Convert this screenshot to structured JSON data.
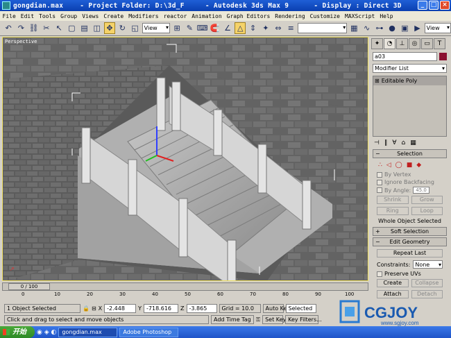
{
  "window": {
    "title": "gongdian.max    - Project Folder: D:\\3d_F     - Autodesk 3ds Max 9      - Display : Direct 3D"
  },
  "menu": [
    "File",
    "Edit",
    "Tools",
    "Group",
    "Views",
    "Create",
    "Modifiers",
    "reactor",
    "Animation",
    "Graph Editors",
    "Rendering",
    "Customize",
    "MAXScript",
    "Help"
  ],
  "toolbar": {
    "refcoord_label": "View",
    "named_sel_label": "View"
  },
  "viewport": {
    "label": "Perspective"
  },
  "command_panel": {
    "object_name": "a03",
    "object_color": "#8a1030",
    "modifier_list_label": "Modifier List",
    "stack_item": "Editable Poly",
    "selection_title": "Selection",
    "by_vertex": "By Vertex",
    "ignore_backfacing": "Ignore Backfacing",
    "by_angle": "By Angle:",
    "angle_value": "45.0",
    "shrink": "Shrink",
    "grow": "Grow",
    "ring": "Ring",
    "loop": "Loop",
    "whole_object": "Whole Object Selected",
    "soft_selection": "Soft Selection",
    "edit_geometry": "Edit Geometry",
    "repeat_last": "Repeat Last",
    "constraints_label": "Constraints:",
    "constraints_value": "None",
    "preserve_uvs": "Preserve UVs",
    "create": "Create",
    "collapse": "Collapse",
    "attach": "Attach",
    "detach": "Detach"
  },
  "timeline": {
    "frame_label": "0 / 100",
    "ticks": [
      "0",
      "10",
      "20",
      "30",
      "40",
      "50",
      "60",
      "70",
      "80",
      "90",
      "100"
    ]
  },
  "status": {
    "selection": "1 Object Selected",
    "x_label": "X",
    "x_value": "-2.448",
    "y_label": "Y",
    "y_value": "-718.616",
    "z_label": "Z",
    "z_value": "-3.865",
    "grid": "Grid = 10.0",
    "auto_key": "Auto Key",
    "selected": "Selected",
    "prompt": "Click and drag to select and move objects",
    "add_time_tag": "Add Time Tag",
    "set_key": "Set Key",
    "key_filters": "Key Filters..."
  },
  "taskbar": {
    "start_label": "开始",
    "tasks": [
      "gongdian.max",
      "Adobe Photoshop"
    ]
  },
  "watermark": {
    "brand": "CGJOY",
    "url": "www.sgjoy.com"
  }
}
